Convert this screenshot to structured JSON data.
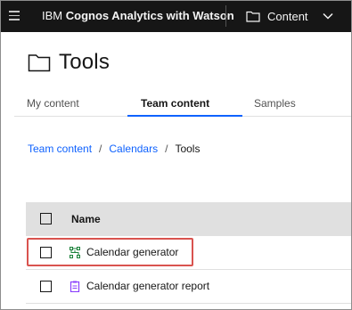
{
  "topbar": {
    "brand_prefix": "IBM",
    "brand_name": "Cognos Analytics with Watson",
    "content_label": "Content"
  },
  "page": {
    "title": "Tools"
  },
  "tabs": [
    {
      "label": "My content",
      "active": false
    },
    {
      "label": "Team content",
      "active": true
    },
    {
      "label": "Samples",
      "active": false
    }
  ],
  "breadcrumb": {
    "items": [
      "Team content",
      "Calendars"
    ],
    "separator": "/",
    "current": "Tools"
  },
  "table": {
    "header_name": "Name",
    "rows": [
      {
        "label": "Calendar generator",
        "icon": "flow-icon",
        "highlighted": true
      },
      {
        "label": "Calendar generator report",
        "icon": "report-icon",
        "highlighted": false
      }
    ]
  },
  "colors": {
    "topbar_bg": "#161616",
    "accent": "#0f62fe",
    "highlight_border": "#d9534f",
    "flow_icon": "#198038",
    "report_icon": "#8a3ffc",
    "table_header_bg": "#e0e0e0"
  }
}
